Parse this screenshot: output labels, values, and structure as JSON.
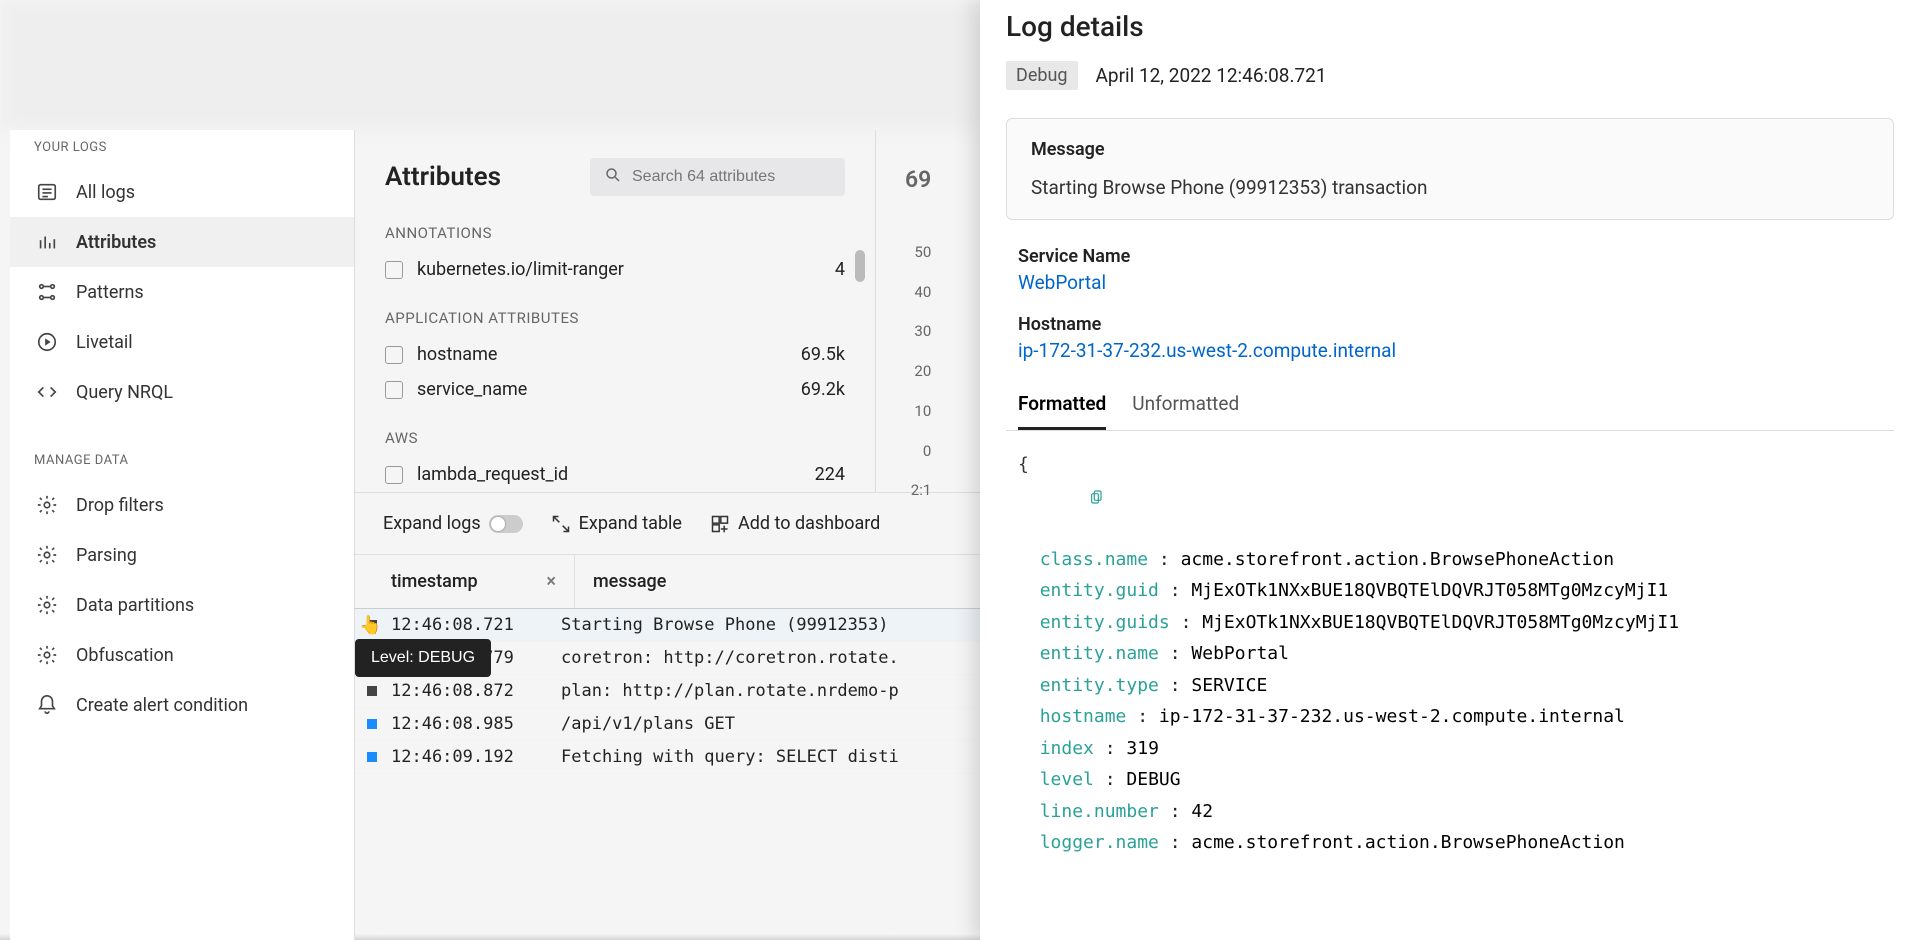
{
  "sidebar": {
    "section1": "YOUR LOGS",
    "items1": [
      {
        "label": "All logs"
      },
      {
        "label": "Attributes"
      },
      {
        "label": "Patterns"
      },
      {
        "label": "Livetail"
      },
      {
        "label": "Query NRQL"
      }
    ],
    "section2": "MANAGE DATA",
    "items2": [
      {
        "label": "Drop filters"
      },
      {
        "label": "Parsing"
      },
      {
        "label": "Data partitions"
      },
      {
        "label": "Obfuscation"
      },
      {
        "label": "Create alert condition"
      }
    ]
  },
  "attrs": {
    "title": "Attributes",
    "search_placeholder": "Search 64 attributes",
    "groups": [
      {
        "title": "ANNOTATIONS",
        "rows": [
          {
            "label": "kubernetes.io/limit-ranger",
            "count": "4"
          }
        ]
      },
      {
        "title": "APPLICATION ATTRIBUTES",
        "rows": [
          {
            "label": "hostname",
            "count": "69.5k"
          },
          {
            "label": "service_name",
            "count": "69.2k"
          }
        ]
      },
      {
        "title": "AWS",
        "rows": [
          {
            "label": "lambda_request_id",
            "count": "224"
          }
        ]
      }
    ]
  },
  "axis": {
    "big": "69",
    "ticks": [
      "50",
      "40",
      "30",
      "20",
      "10",
      "0",
      "2:1"
    ]
  },
  "toolbar": {
    "expand_logs": "Expand logs",
    "expand_table": "Expand table",
    "add_dash": "Add to dashboard"
  },
  "columns": {
    "ts": "timestamp",
    "msg": "message"
  },
  "rows": [
    {
      "level": "debug",
      "ts": "12:46:08.721",
      "msg": "Starting Browse Phone (99912353)"
    },
    {
      "level": "debug",
      "ts": "12:46:08.779",
      "msg": "coretron: http://coretron.rotate."
    },
    {
      "level": "debug",
      "ts": "12:46:08.872",
      "msg": "plan: http://plan.rotate.nrdemo-p"
    },
    {
      "level": "info",
      "ts": "12:46:08.985",
      "msg": "/api/v1/plans GET"
    },
    {
      "level": "info",
      "ts": "12:46:09.192",
      "msg": "Fetching with query: SELECT disti"
    }
  ],
  "tooltip": "Level: DEBUG",
  "details": {
    "title": "Log details",
    "level": "Debug",
    "date": "April 12, 2022 12:46:08.721",
    "msg_label": "Message",
    "msg": "Starting Browse Phone (99912353) transaction",
    "service_k": "Service Name",
    "service_v": "WebPortal",
    "host_k": "Hostname",
    "host_v": "ip-172-31-37-232.us-west-2.compute.internal",
    "tab_fmt": "Formatted",
    "tab_unfmt": "Unformatted",
    "json": [
      {
        "k": "class.name",
        "v": "acme.storefront.action.BrowsePhoneAction"
      },
      {
        "k": "entity.guid",
        "v": "MjExOTk1NXxBUE18QVBQTElDQVRJT058MTg0MzcyMjI1"
      },
      {
        "k": "entity.guids",
        "v": "MjExOTk1NXxBUE18QVBQTElDQVRJT058MTg0MzcyMjI1"
      },
      {
        "k": "entity.name",
        "v": "WebPortal"
      },
      {
        "k": "entity.type",
        "v": "SERVICE"
      },
      {
        "k": "hostname",
        "v": "ip-172-31-37-232.us-west-2.compute.internal"
      },
      {
        "k": "index",
        "v": "319"
      },
      {
        "k": "level",
        "v": "DEBUG"
      },
      {
        "k": "line.number",
        "v": "42"
      },
      {
        "k": "logger.name",
        "v": "acme.storefront.action.BrowsePhoneAction"
      }
    ]
  }
}
